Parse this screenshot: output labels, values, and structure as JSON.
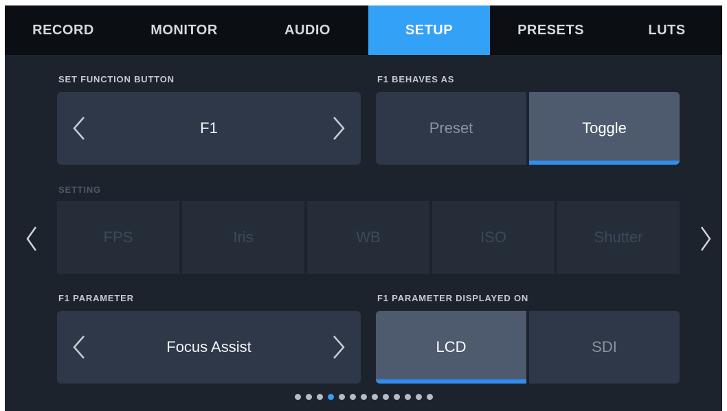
{
  "tabs": [
    {
      "label": "RECORD",
      "active": false
    },
    {
      "label": "MONITOR",
      "active": false
    },
    {
      "label": "AUDIO",
      "active": false
    },
    {
      "label": "SETUP",
      "active": true
    },
    {
      "label": "PRESETS",
      "active": false
    },
    {
      "label": "LUTS",
      "active": false
    }
  ],
  "function_button": {
    "label": "SET FUNCTION BUTTON",
    "value": "F1"
  },
  "behaves_as": {
    "label": "F1 BEHAVES AS",
    "options": [
      "Preset",
      "Toggle"
    ],
    "selected": "Toggle"
  },
  "setting": {
    "label": "SETTING",
    "options": [
      "FPS",
      "Iris",
      "WB",
      "ISO",
      "Shutter"
    ],
    "enabled": false
  },
  "parameter": {
    "label": "F1 PARAMETER",
    "value": "Focus Assist"
  },
  "displayed_on": {
    "label": "F1 PARAMETER DISPLAYED ON",
    "options": [
      "LCD",
      "SDI"
    ],
    "selected": "LCD"
  },
  "pagination": {
    "total": 13,
    "current": 4
  },
  "colors": {
    "accent": "#33a1f5",
    "underline": "#2f8ef0",
    "background": "#1c232d",
    "panel": "#2e3848",
    "selected": "#4e5a6e"
  }
}
